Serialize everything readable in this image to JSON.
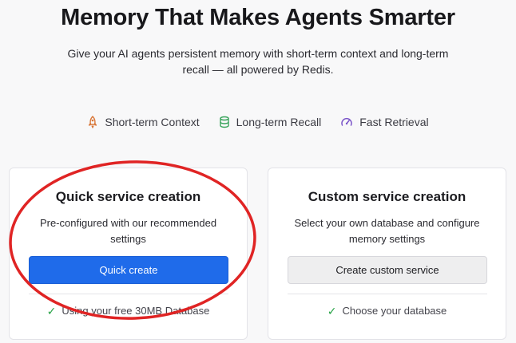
{
  "hero": {
    "title": "Memory That Makes Agents Smarter",
    "subtitle": "Give your AI agents persistent memory with short-term context and long-term recall — all powered by Redis."
  },
  "features": [
    {
      "label": "Short-term Context",
      "icon": "rocket-icon",
      "color": "#d9783a"
    },
    {
      "label": "Long-term Recall",
      "icon": "database-icon",
      "color": "#37a35a"
    },
    {
      "label": "Fast Retrieval",
      "icon": "speedometer-icon",
      "color": "#7b55c9"
    }
  ],
  "cards": {
    "quick": {
      "title": "Quick service creation",
      "description": "Pre-configured with our recommended settings",
      "button_label": "Quick create",
      "footnote": "Using your free 30MB Database"
    },
    "custom": {
      "title": "Custom service creation",
      "description": "Select your own database and configure memory settings",
      "button_label": "Create custom service",
      "footnote": "Choose your database"
    }
  },
  "colors": {
    "primary": "#1f6bea",
    "check": "#25a244",
    "annotation": "#e02424"
  }
}
